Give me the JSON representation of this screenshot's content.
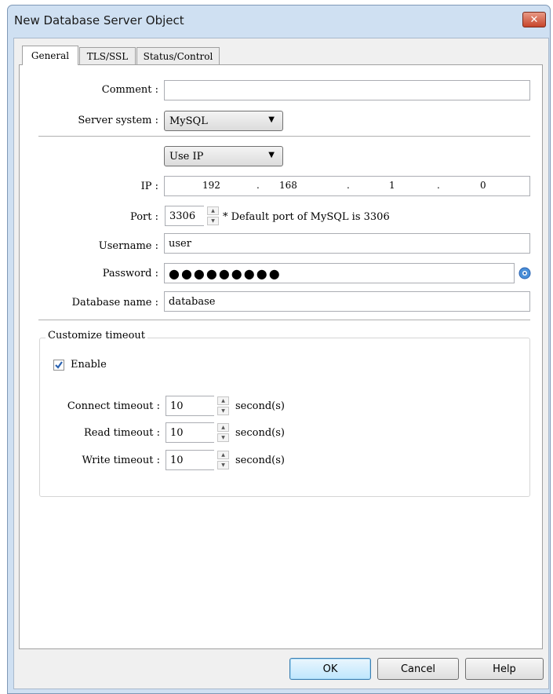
{
  "window": {
    "title": "New Database Server Object",
    "close_symbol": "✕"
  },
  "tabs": [
    "General",
    "TLS/SSL",
    "Status/Control"
  ],
  "general": {
    "comment_label": "Comment :",
    "comment_value": "",
    "server_system_label": "Server system :",
    "server_system_value": "MySQL",
    "address_mode": "Use IP",
    "ip_label": "IP :",
    "ip": [
      "192",
      "168",
      "1",
      "0"
    ],
    "ip_separator": ".",
    "port_label": "Port :",
    "port_value": "3306",
    "port_note": "* Default port of MySQL is 3306",
    "username_label": "Username :",
    "username_value": "user",
    "password_label": "Password :",
    "password_mask": "●●●●●●●●●",
    "database_name_label": "Database name :",
    "database_name_value": "database"
  },
  "timeout": {
    "group_title": "Customize timeout",
    "enable_label": "Enable",
    "enable_checked": true,
    "unit": "second(s)",
    "rows": [
      {
        "label": "Connect timeout :",
        "value": "10"
      },
      {
        "label": "Read timeout :",
        "value": "10"
      },
      {
        "label": "Write timeout :",
        "value": "10"
      }
    ]
  },
  "buttons": {
    "ok": "OK",
    "cancel": "Cancel",
    "help": "Help"
  },
  "icons": {
    "dropdown": "chevron-down-icon",
    "spin": "spin-arrows-icon",
    "show_password": "eye-icon",
    "checkbox": "checkmark-icon"
  },
  "colors": {
    "title_bar": "#cfe0f2",
    "close_button": "#c7452b",
    "check": "#2a62b0"
  }
}
